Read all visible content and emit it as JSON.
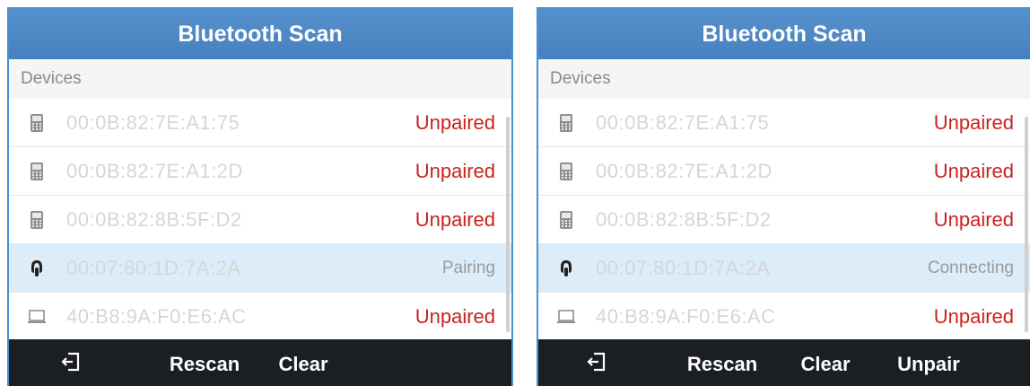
{
  "screens": [
    {
      "title": "Bluetooth Scan",
      "section": "Devices",
      "devices": [
        {
          "icon": "phone-icon",
          "address": "00:0B:82:7E:A1:75",
          "status": "Unpaired"
        },
        {
          "icon": "phone-icon",
          "address": "00:0B:82:7E:A1:2D",
          "status": "Unpaired"
        },
        {
          "icon": "phone-icon",
          "address": "00:0B:82:8B:5F:D2",
          "status": "Unpaired"
        },
        {
          "icon": "headset-icon",
          "address": "00:07:80:1D:7A:2A",
          "status": "Pairing"
        },
        {
          "icon": "laptop-icon",
          "address": "40:B8:9A:F0:E6:AC",
          "status": "Unpaired"
        }
      ],
      "softkeys": {
        "back_icon": "exit-icon",
        "rescan": "Rescan",
        "clear": "Clear"
      }
    },
    {
      "title": "Bluetooth Scan",
      "section": "Devices",
      "devices": [
        {
          "icon": "phone-icon",
          "address": "00:0B:82:7E:A1:75",
          "status": "Unpaired"
        },
        {
          "icon": "phone-icon",
          "address": "00:0B:82:7E:A1:2D",
          "status": "Unpaired"
        },
        {
          "icon": "phone-icon",
          "address": "00:0B:82:8B:5F:D2",
          "status": "Unpaired"
        },
        {
          "icon": "headset-icon",
          "address": "00:07:80:1D:7A:2A",
          "status": "Connecting"
        },
        {
          "icon": "laptop-icon",
          "address": "40:B8:9A:F0:E6:AC",
          "status": "Unpaired"
        }
      ],
      "softkeys": {
        "back_icon": "exit-icon",
        "rescan": "Rescan",
        "clear": "Clear",
        "unpair": "Unpair"
      }
    }
  ],
  "colors": {
    "titlebar": "#4a85c3",
    "unpaired": "#c8221e",
    "selected_row": "#dcecf8",
    "softkey_bar": "#1b1e22"
  }
}
